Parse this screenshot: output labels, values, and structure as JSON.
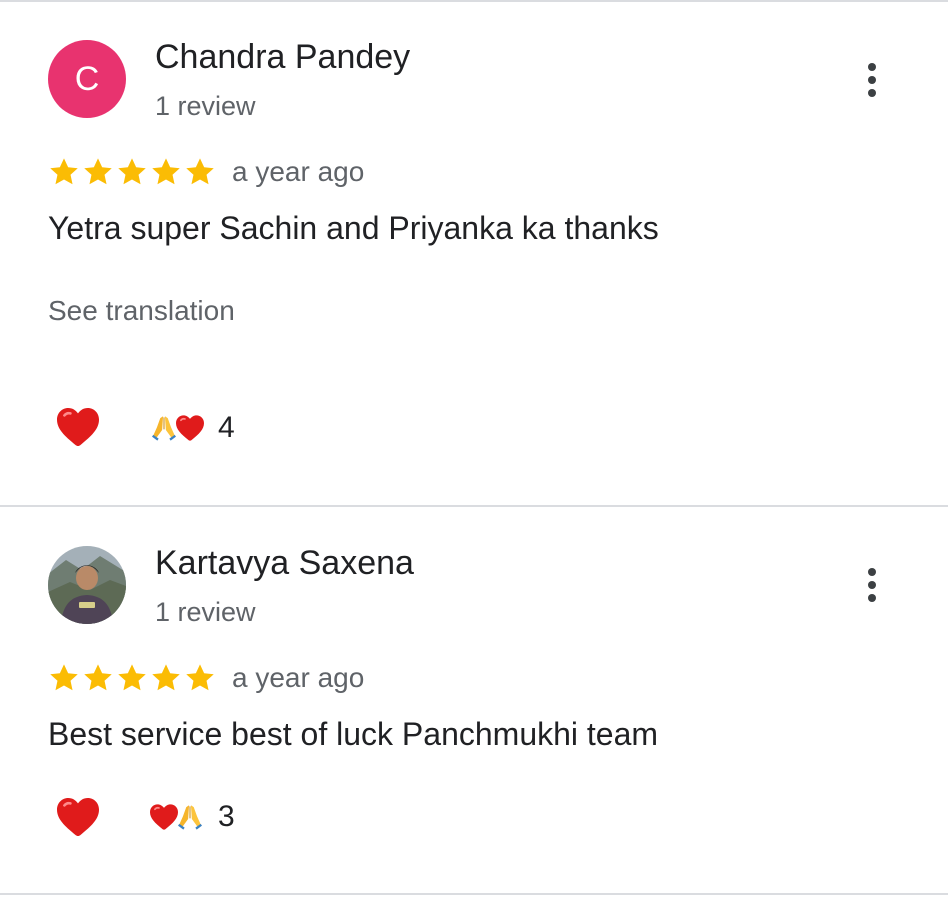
{
  "reviews": [
    {
      "author": "Chandra Pandey",
      "avatar_letter": "C",
      "avatar_color": "#e8336f",
      "review_count": "1 review",
      "rating": 5,
      "time": "a year ago",
      "text": "Yetra super Sachin and Priyanka ka thanks",
      "see_translation": "See translation",
      "reactions": [
        "folded-hands-icon",
        "heart-icon"
      ],
      "reaction_count": "4"
    },
    {
      "author": "Kartavya Saxena",
      "avatar": "profile-photo",
      "review_count": "1 review",
      "rating": 5,
      "time": "a year ago",
      "text": "Best service best of luck Panchmukhi team",
      "reactions": [
        "heart-icon",
        "folded-hands-icon"
      ],
      "reaction_count": "3"
    }
  ],
  "colors": {
    "star": "#fbbc04",
    "heart": "#e01b1b",
    "divider": "#dadce0",
    "secondary_text": "#5f6368"
  }
}
